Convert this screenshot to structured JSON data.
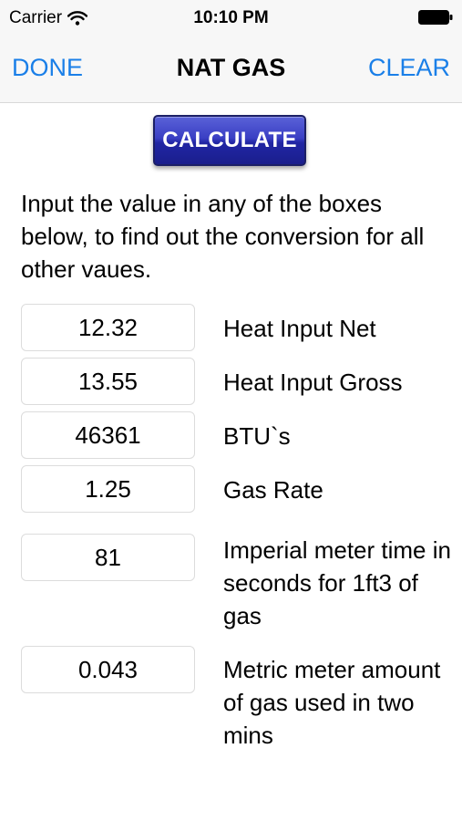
{
  "status_bar": {
    "carrier": "Carrier",
    "time": "10:10 PM",
    "wifi_icon": "wifi-icon",
    "battery_icon": "battery-icon"
  },
  "nav": {
    "left_label": "DONE",
    "title": "NAT GAS",
    "right_label": "CLEAR",
    "accent_color": "#1a7fe8"
  },
  "calculate_label": "CALCULATE",
  "instructions": "Input the value in any of the boxes below, to find out the conversion for all other vaues.",
  "rows": [
    {
      "value": "12.32",
      "label": "Heat Input Net"
    },
    {
      "value": "13.55",
      "label": "Heat Input Gross"
    },
    {
      "value": "46361",
      "label": "BTU`s"
    },
    {
      "value": "1.25",
      "label": "Gas Rate"
    },
    {
      "value": "81",
      "label": "Imperial meter time in seconds for 1ft3 of gas"
    },
    {
      "value": "0.043",
      "label": "Metric meter amount of gas used in two mins"
    }
  ]
}
